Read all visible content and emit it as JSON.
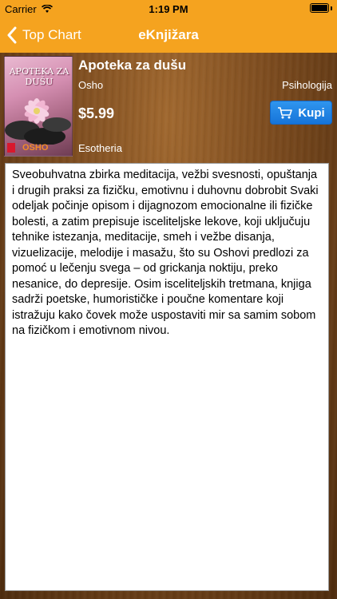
{
  "status_bar": {
    "carrier": "Carrier",
    "time": "1:19 PM"
  },
  "nav": {
    "back_label": "Top Chart",
    "title": "eKnjižara"
  },
  "book": {
    "cover_title": "APOTEKA ZA DUŠU",
    "cover_author": "OSHO",
    "title": "Apoteka za dušu",
    "author": "Osho",
    "category": "Psihologija",
    "price": "$5.99",
    "buy_label": "Kupi",
    "publisher": "Esotheria"
  },
  "description": "Sveobuhvatna zbirka meditacija, vežbi svesnosti, opuštanja i drugih praksi za fizičku, emotivnu i duhovnu dobrobit Svaki odeljak počinje opisom i dijagnozom emocionalne ili fizičke bolesti, a zatim prepisuje isceliteljske lekove, koji uključuju tehnike istezanja, meditacije, smeh i vežbe disanja, vizuelizacije, melodije i masažu, što su Oshovi predlozi za pomoć u lečenju svega – od grickanja noktiju, preko nesanice, do depresije. Osim isceliteljskih tretmana, knjiga sadrži poetske, humorističke i poučne komentare koji istražuju kako čovek može uspostaviti mir sa samim sobom na fizičkom i emotivnom nivou.",
  "colors": {
    "nav_orange": "#f5a31f",
    "buy_blue": "#1e82e4",
    "wood": "#7a4a1e"
  }
}
